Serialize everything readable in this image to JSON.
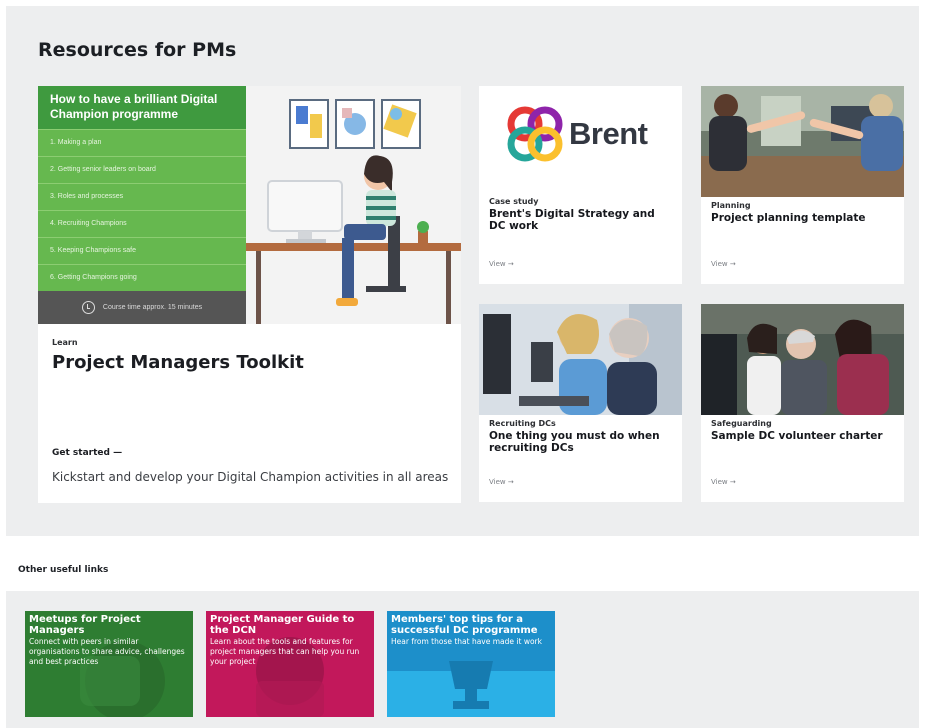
{
  "section": {
    "title": "Resources for PMs"
  },
  "toolkit": {
    "course_title": "How to have a brilliant Digital Champion programme",
    "course_items": [
      "1. Making a plan",
      "2. Getting senior leaders on board",
      "3. Roles and processes",
      "4. Recruiting Champions",
      "5. Keeping Champions safe",
      "6. Getting Champions going"
    ],
    "course_time": "Course time approx. 15 minutes",
    "category": "Learn",
    "title": "Project Managers Toolkit",
    "cta": "Get started —",
    "description": "Kickstart and develop your Digital Champion activities in all areas"
  },
  "cards": [
    {
      "category": "Case study",
      "title": "Brent's Digital Strategy and DC work",
      "view": "View →",
      "logo_text": "Brent"
    },
    {
      "category": "Planning",
      "title": "Project planning template",
      "view": "View →"
    },
    {
      "category": "Recruiting DCs",
      "title": "One thing you must do when recruiting DCs",
      "view": "View →"
    },
    {
      "category": "Safeguarding",
      "title": "Sample DC volunteer charter",
      "view": "View →"
    }
  ],
  "other": {
    "heading": "Other useful links",
    "tiles": [
      {
        "title": "Meetups for Project Managers",
        "desc": "Connect with peers in similar organisations to share advice, challenges and best practices",
        "color": "#2e7d32"
      },
      {
        "title": "Project Manager Guide to the DCN",
        "desc": "Learn about the tools and features for project managers that can help you run your project",
        "color": "#c2185b"
      },
      {
        "title": "Members' top tips for a successful DC programme",
        "desc": "Hear from those that have made it work",
        "color": "#1f9ad6"
      }
    ]
  }
}
